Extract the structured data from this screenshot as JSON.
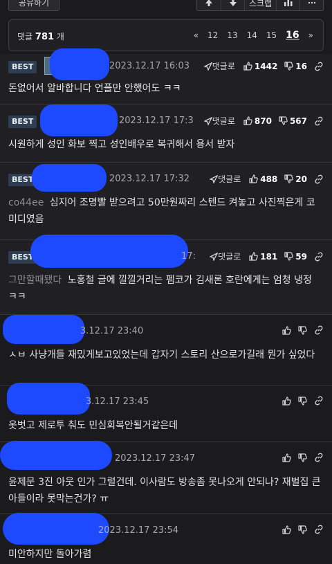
{
  "toolbar": {
    "share_label": "공유하기",
    "scrap_label": "스크랩"
  },
  "pager": {
    "count_prefix": "댓글",
    "count": "781",
    "count_suffix": "개",
    "prev": "«",
    "pages": [
      "12",
      "13",
      "14",
      "15",
      "16"
    ],
    "current": "16",
    "next": "»"
  },
  "comments": [
    {
      "best": "BEST",
      "time": "2023.12.17 16:03",
      "reply": "댓글로",
      "up": "1442",
      "down": "16",
      "mention": "",
      "text": "돈없어서 알바합니다 언플만 안했어도 ㅋㅋ"
    },
    {
      "best": "BEST",
      "time": "2023.12.17 17:3",
      "reply": "댓글로",
      "up": "870",
      "down": "567",
      "mention": "",
      "text": "시원하게 성인 화보 찍고 성인배우로 복귀해서 용서 받자"
    },
    {
      "best": "BEST",
      "time": "2023.12.17 17:32",
      "reply": "댓글로",
      "up": "488",
      "down": "20",
      "mention": "co44ee",
      "text": "심지어 조명빨 받으려고 50만원짜리 스텐드 켜놓고 사진찍은게 코미디였음"
    },
    {
      "best": "BEST",
      "time": "17:",
      "reply": "댓글로",
      "up": "181",
      "down": "59",
      "mention": "그만할때됐다",
      "text": "노홍철 글에 낄낄거리는 펨코가 김새론 호란에게는 엄청 냉정 ㅋㅋ"
    },
    {
      "best": "",
      "time": "3.12.17 23:40",
      "reply": "",
      "up": "",
      "down": "",
      "mention": "",
      "text": "ㅅㅂ 사냥개들 재밌게보고있었는데 갑자기 스토리 산으로가길래 뭔가 싶었다"
    },
    {
      "best": "",
      "time": "3.12.17 23:45",
      "reply": "",
      "up": "",
      "down": "",
      "mention": "",
      "text": "옷벗고 제로투 춰도 민심회복안될거같은데"
    },
    {
      "best": "",
      "time": "2023.12.17 23:47",
      "reply": "",
      "up": "",
      "down": "",
      "mention": "",
      "text": "윤제문 3진 아웃 인가 그럴건데. 이사람도 방송좀 못나오게 안되나? 재벌집 큰아들이라 못막는건가? ㅠ"
    },
    {
      "best": "",
      "time": "2023.12.17 23:54",
      "reply": "",
      "up": "",
      "down": "",
      "mention": "",
      "text": "미안하지만 돌아가렴"
    }
  ],
  "icons": [
    "arrow-up-icon",
    "arrow-down-icon",
    "bar-chart-icon",
    "more-icon",
    "reply-arrow-icon",
    "thumb-up-icon",
    "thumb-down-icon",
    "link-icon"
  ],
  "colors": {
    "background": "#1b1b1d",
    "best_badge": "#2e3d52",
    "censor_blue": "#1d49ff"
  }
}
